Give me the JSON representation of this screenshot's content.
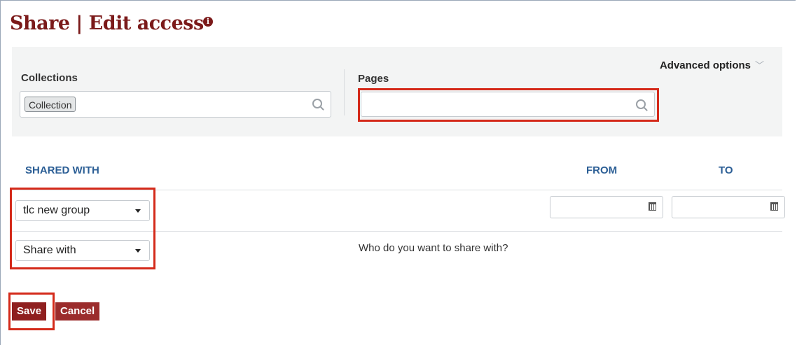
{
  "page": {
    "title": "Share | Edit access",
    "info_icon": "i"
  },
  "filters": {
    "advanced_label": "Advanced options",
    "advanced_chevron": "﹀",
    "collections_label": "Collections",
    "collections_tag": "Collection",
    "pages_label": "Pages",
    "pages_value": ""
  },
  "table": {
    "col_shared": "SHARED WITH",
    "col_from": "FROM",
    "col_to": "TO",
    "row_group_value": "tlc new group",
    "share_with_value": "Share with",
    "share_hint": "Who do you want to share with?"
  },
  "actions": {
    "save_label": "Save",
    "cancel_label": "Cancel"
  },
  "colors": {
    "brand": "#7b1a1a",
    "header_blue": "#2b5e95",
    "highlight_red": "#d42a1a"
  }
}
